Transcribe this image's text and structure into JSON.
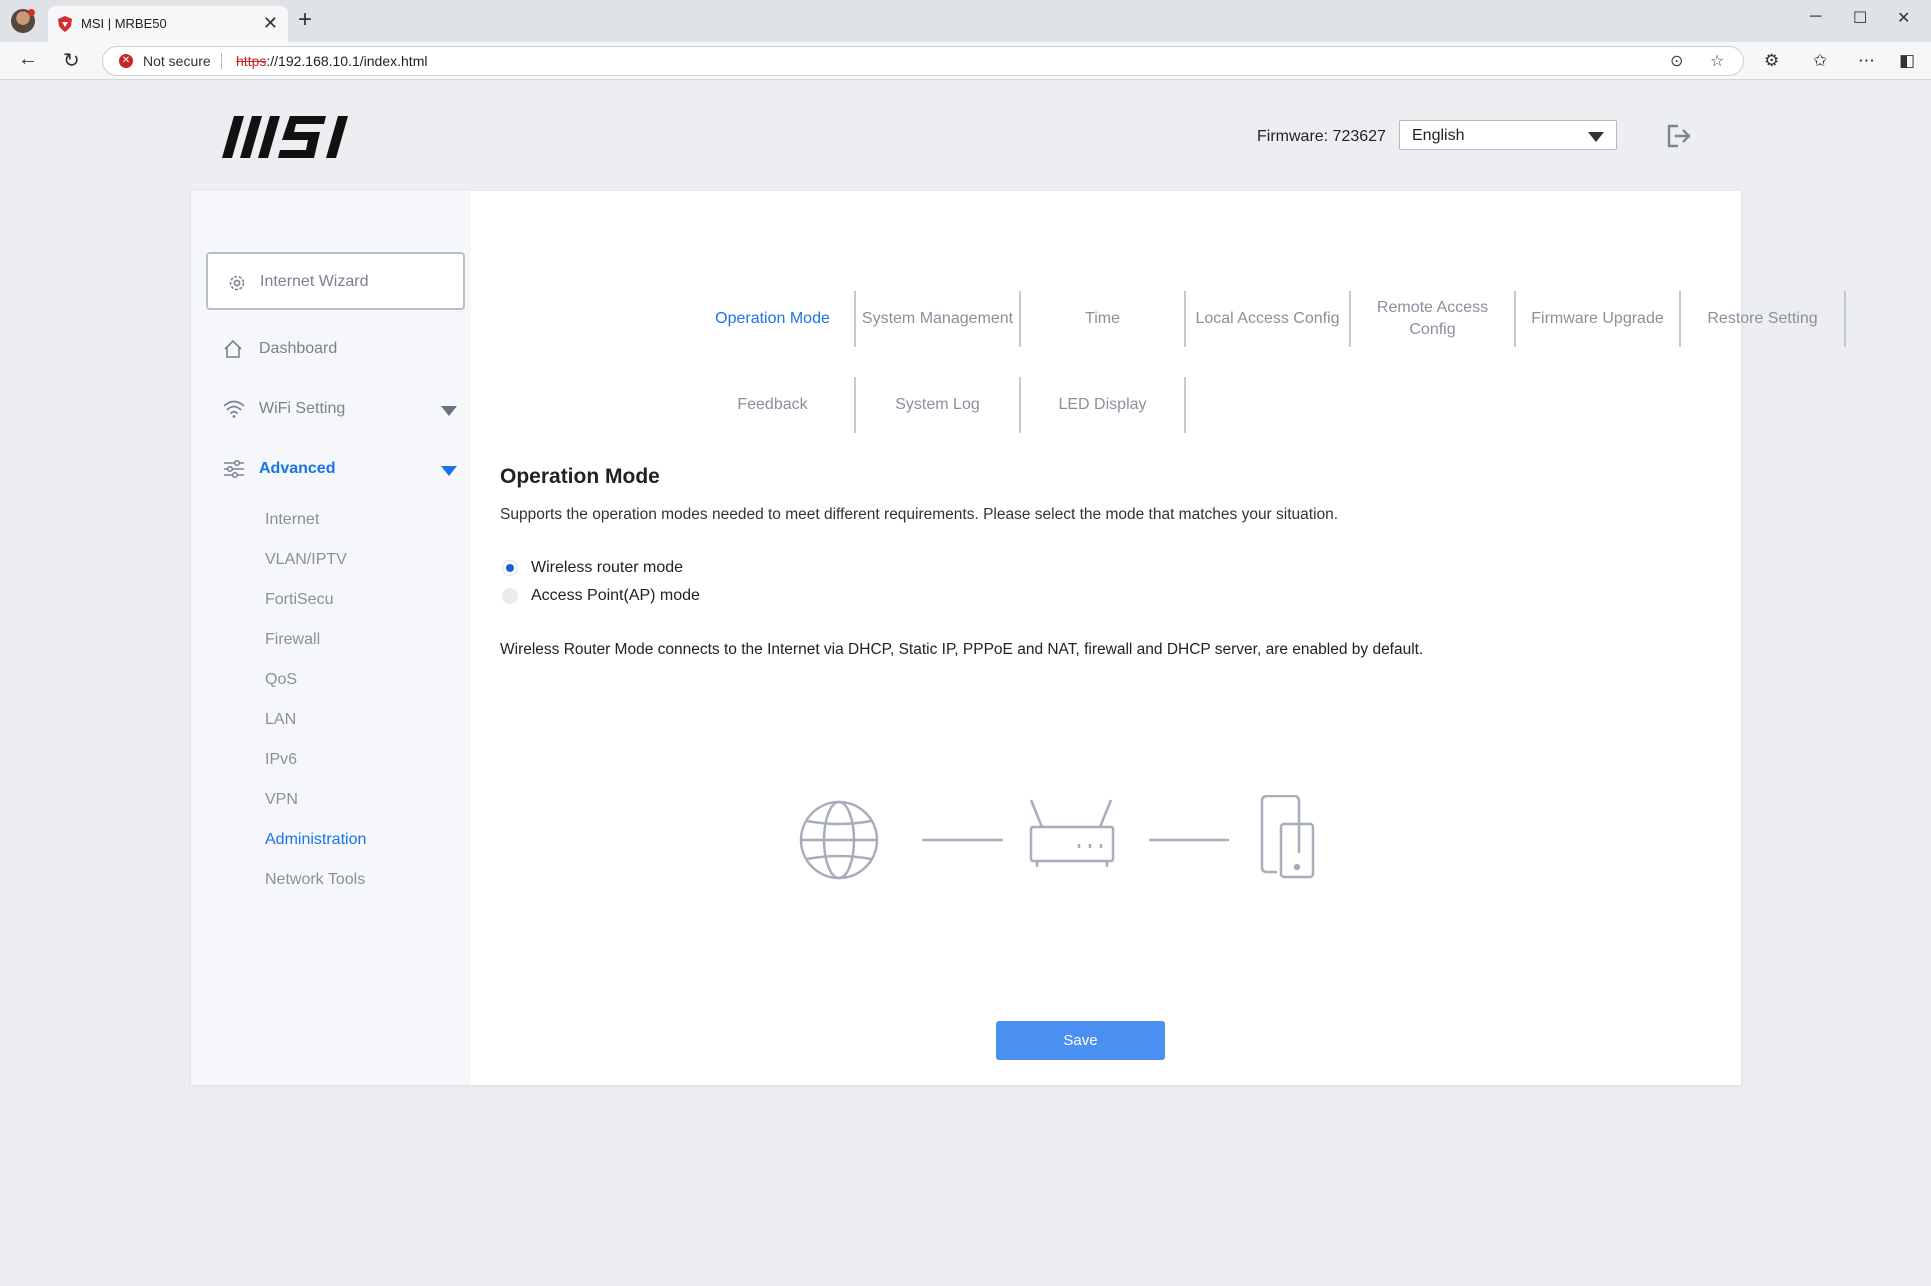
{
  "browser": {
    "tab_title": "MSI | MRBE50",
    "not_secure_label": "Not secure",
    "url_scheme": "https",
    "url_rest": "://192.168.10.1/index.html"
  },
  "header": {
    "firmware_label": "Firmware: 723627",
    "language_value": "English"
  },
  "sidebar": {
    "wizard_label": "Internet Wizard",
    "items": [
      {
        "label": "Dashboard"
      },
      {
        "label": "WiFi Setting"
      },
      {
        "label": "Advanced"
      }
    ],
    "sub_items": [
      "Internet",
      "VLAN/IPTV",
      "FortiSecu",
      "Firewall",
      "QoS",
      "LAN",
      "IPv6",
      "VPN",
      "Administration",
      "Network Tools"
    ]
  },
  "tabs": [
    "Operation Mode",
    "System Management",
    "Time",
    "Local Access Config",
    "Remote Access Config",
    "Firmware Upgrade",
    "Restore Setting",
    "Feedback",
    "System Log",
    "LED Display"
  ],
  "content": {
    "title": "Operation Mode",
    "description": "Supports the operation modes needed to meet different requirements. Please select the mode that matches your situation.",
    "options": [
      "Wireless router mode",
      "Access Point(AP) mode"
    ],
    "selected_option": "Wireless router mode",
    "mode_description": "Wireless Router Mode connects to the Internet via DHCP, Static IP, PPPoE and NAT, firewall and DHCP server, are enabled by default.",
    "save_label": "Save"
  }
}
